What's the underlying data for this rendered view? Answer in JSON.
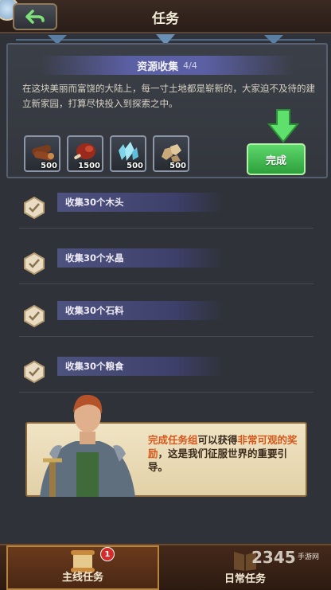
{
  "header": {
    "title": "任务"
  },
  "quest": {
    "title": "资源收集",
    "progress": "4/4",
    "description": "在这块美丽而富饶的大陆上，每一寸土地都是崭新的，大家迫不及待的建立新家园，打算尽快投入到探索之中。",
    "resources": [
      {
        "icon": "wood-icon",
        "count": "500"
      },
      {
        "icon": "meat-icon",
        "count": "1500"
      },
      {
        "icon": "crystal-icon",
        "count": "500"
      },
      {
        "icon": "stone-icon",
        "count": "500"
      }
    ],
    "complete_label": "完成"
  },
  "tasks": [
    {
      "label": "收集30个木头"
    },
    {
      "label": "收集30个水晶"
    },
    {
      "label": "收集30个石料"
    },
    {
      "label": "收集30个粮食"
    }
  ],
  "banner": {
    "part1": "完成任务组",
    "part2": "可以获得",
    "part3": "非常可观的奖励",
    "part4": "，这是我们征服世界的重要引导。"
  },
  "nav": {
    "main_label": "主线任务",
    "main_badge": "1",
    "daily_label": "日常任务"
  },
  "watermark": {
    "text": "2345",
    "sub": "手游网"
  },
  "colors": {
    "accent_green": "#3fbf4f",
    "header_purple": "#5b5fa3",
    "highlight": "#d6581b"
  }
}
